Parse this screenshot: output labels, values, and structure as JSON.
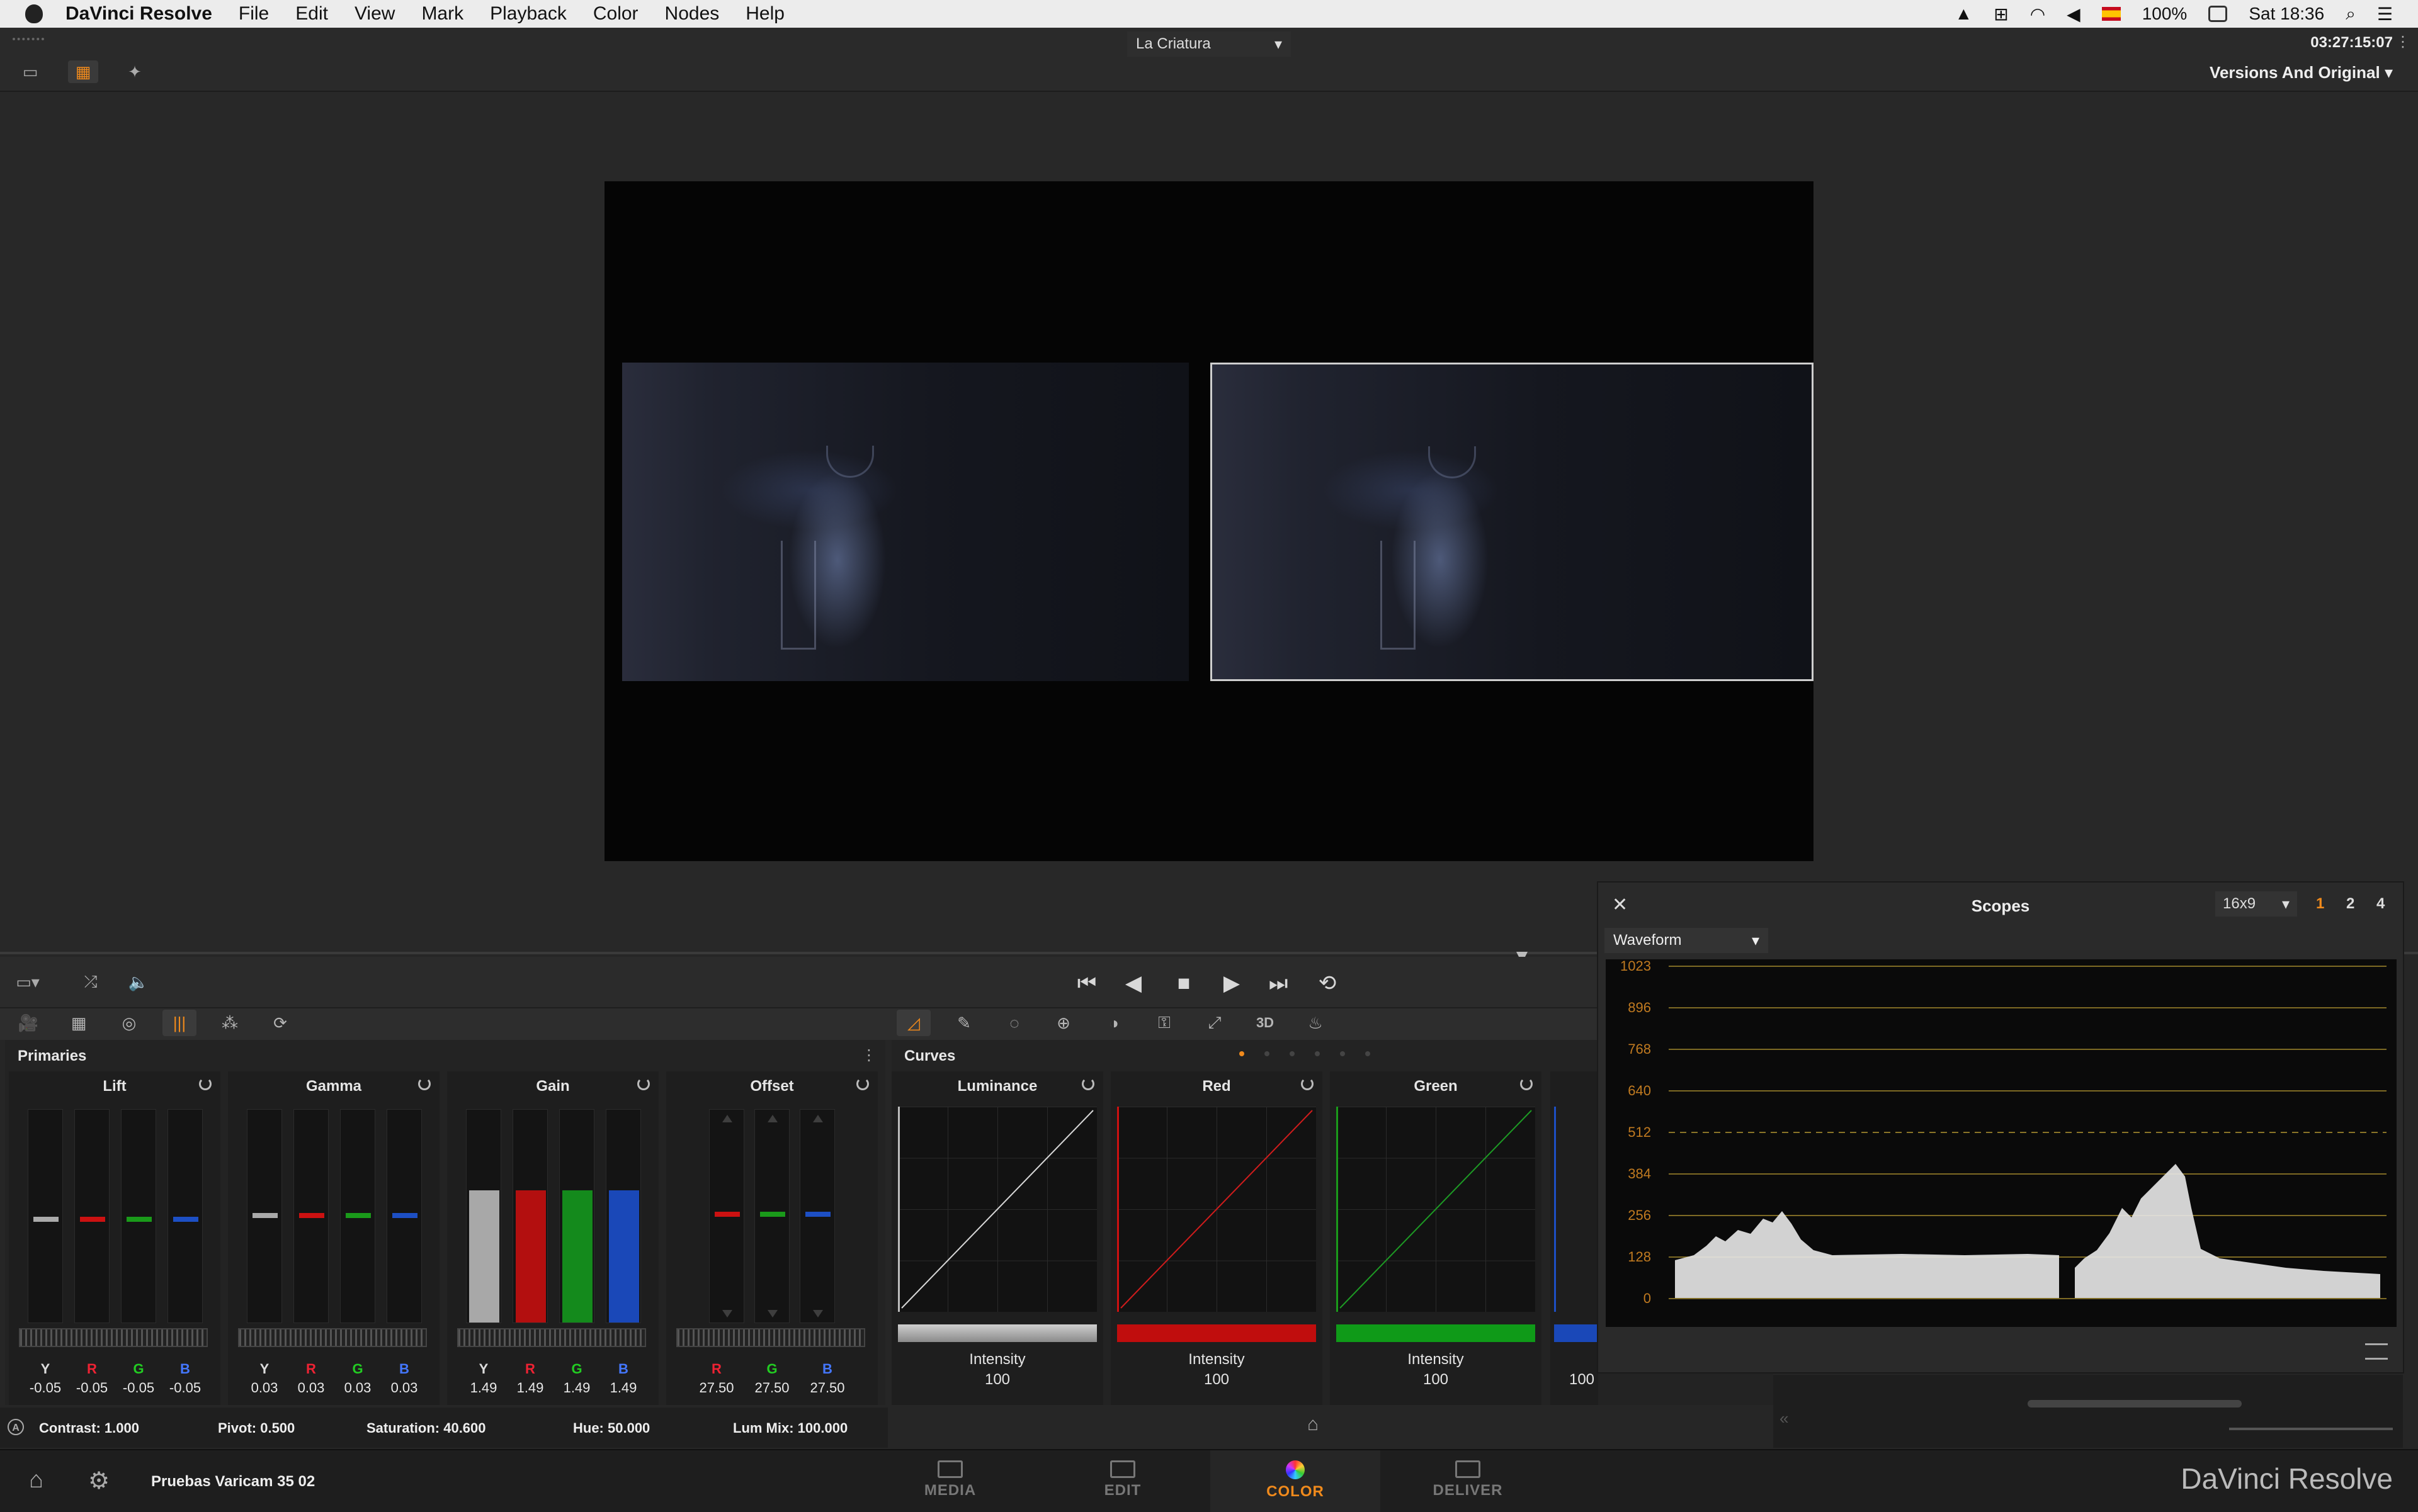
{
  "menubar": {
    "app_name": "DaVinci Resolve",
    "items": [
      "File",
      "Edit",
      "View",
      "Mark",
      "Playback",
      "Color",
      "Nodes",
      "Help"
    ],
    "battery": "100%",
    "clock": "Sat 18:36"
  },
  "topbar": {
    "project_title": "La Criatura",
    "timecode": "03:27:15:07",
    "versions_dropdown": "Versions And Original"
  },
  "primaries": {
    "title": "Primaries",
    "lift": {
      "title": "Lift",
      "labels": [
        "Y",
        "R",
        "G",
        "B"
      ],
      "values": [
        "-0.05",
        "-0.05",
        "-0.05",
        "-0.05"
      ]
    },
    "gamma": {
      "title": "Gamma",
      "labels": [
        "Y",
        "R",
        "G",
        "B"
      ],
      "values": [
        "0.03",
        "0.03",
        "0.03",
        "0.03"
      ]
    },
    "gain": {
      "title": "Gain",
      "labels": [
        "Y",
        "R",
        "G",
        "B"
      ],
      "values": [
        "1.49",
        "1.49",
        "1.49",
        "1.49"
      ]
    },
    "offset": {
      "title": "Offset",
      "labels": [
        "R",
        "G",
        "B"
      ],
      "values": [
        "27.50",
        "27.50",
        "27.50"
      ]
    }
  },
  "status": {
    "contrast": "Contrast: 1.000",
    "pivot": "Pivot: 0.500",
    "saturation": "Saturation: 40.600",
    "hue": "Hue: 50.000",
    "lum_mix": "Lum Mix: 100.000"
  },
  "curves": {
    "title": "Curves",
    "columns": [
      {
        "title": "Luminance",
        "intensity_label": "Intensity",
        "intensity_value": "100"
      },
      {
        "title": "Red",
        "intensity_label": "Intensity",
        "intensity_value": "100"
      },
      {
        "title": "Green",
        "intensity_label": "Intensity",
        "intensity_value": "100"
      }
    ],
    "hidden_value": "100"
  },
  "scopes": {
    "title": "Scopes",
    "aspect": "16x9",
    "layout_options": [
      "1",
      "2",
      "4"
    ],
    "mode": "Waveform",
    "scale": [
      "1023",
      "896",
      "768",
      "640",
      "512",
      "384",
      "256",
      "128",
      "0"
    ],
    "accent": "#f08a1c"
  },
  "pages": {
    "project_name": "Pruebas Varicam 35 02",
    "tabs": [
      "MEDIA",
      "EDIT",
      "COLOR",
      "DELIVER"
    ],
    "active": "COLOR",
    "brand": "DaVinci Resolve"
  }
}
